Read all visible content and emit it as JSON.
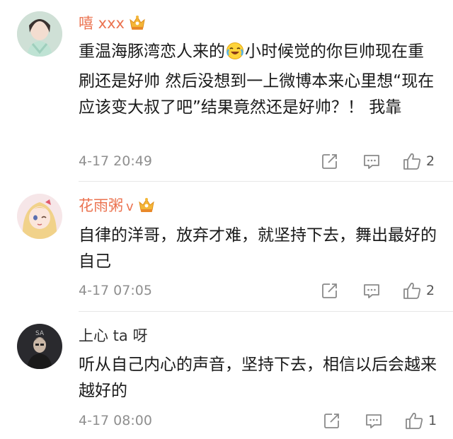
{
  "comments": [
    {
      "username": "嘻 xxx",
      "text_part1": "重温海豚湾恋人来的",
      "text_part2": "小时候觉的你巨帅现在重刷还是好帅 然后没想到一上微博本来心里想“现在应该变大叔了吧”结果竟然还是好帅？！ 我靠",
      "emoji": "laughing-crying-emoji",
      "time": "4-17 20:49",
      "likes": "2"
    },
    {
      "username": "花雨粥",
      "verified": "v",
      "text": "自律的洋哥，放弃才难，就坚持下去，舞出最好的自己",
      "time": "4-17 07:05",
      "likes": "2"
    },
    {
      "username": "上心 ta 呀",
      "text": "听从自己内心的声音，坚持下去，相信以后会越来越好的",
      "time": "4-17 08:00",
      "likes": "1"
    }
  ],
  "icons": {
    "share": "share-icon",
    "reply": "comment-icon",
    "like": "thumbs-up-icon",
    "badge": "crown-badge-icon"
  },
  "colors": {
    "username_accent": "#eb7350",
    "text": "#1a1a1a",
    "meta_gray": "#8f8f8f",
    "divider": "#e6e6e6"
  }
}
